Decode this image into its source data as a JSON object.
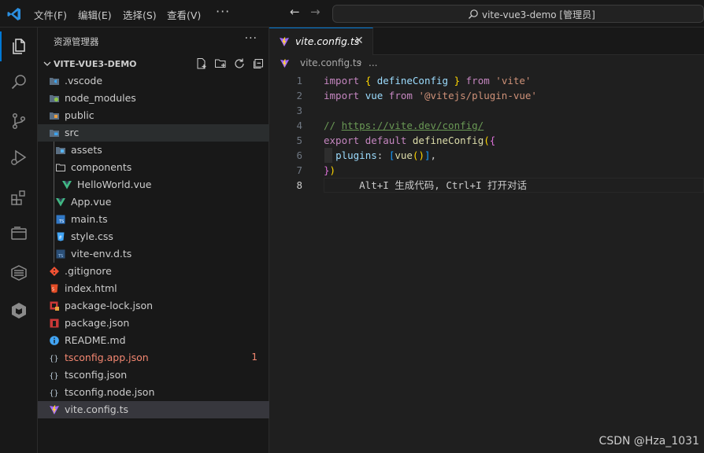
{
  "titlebar": {
    "menus": [
      "文件(F)",
      "编辑(E)",
      "选择(S)",
      "查看(V)"
    ],
    "more": "···",
    "back_arrow": "←",
    "forward_arrow": "→",
    "command_center_text": "vite-vue3-demo [管理员]"
  },
  "sidebar": {
    "title": "资源管理器",
    "more": "···",
    "section_title": "VITE-VUE3-DEMO",
    "tree": [
      {
        "label": ".vscode",
        "icon": "vscode-folder-icon",
        "depth": 0
      },
      {
        "label": "node_modules",
        "icon": "node-folder-icon",
        "depth": 0
      },
      {
        "label": "public",
        "icon": "public-folder-icon",
        "depth": 0
      },
      {
        "label": "src",
        "icon": "src-folder-open-icon",
        "depth": 0
      },
      {
        "label": "assets",
        "icon": "assets-folder-icon",
        "depth": 1
      },
      {
        "label": "components",
        "icon": "folder-outline-icon",
        "depth": 1
      },
      {
        "label": "HelloWorld.vue",
        "icon": "vue-file-icon",
        "depth": 2
      },
      {
        "label": "App.vue",
        "icon": "vue-file-icon",
        "depth": 1
      },
      {
        "label": "main.ts",
        "icon": "ts-file-icon",
        "depth": 1
      },
      {
        "label": "style.css",
        "icon": "css-file-icon",
        "depth": 1
      },
      {
        "label": "vite-env.d.ts",
        "icon": "ts-def-file-icon",
        "depth": 1
      },
      {
        "label": ".gitignore",
        "icon": "git-file-icon",
        "depth": 0
      },
      {
        "label": "index.html",
        "icon": "html-file-icon",
        "depth": 0
      },
      {
        "label": "package-lock.json",
        "icon": "npm-lock-file-icon",
        "depth": 0
      },
      {
        "label": "package.json",
        "icon": "npm-file-icon",
        "depth": 0
      },
      {
        "label": "README.md",
        "icon": "info-file-icon",
        "depth": 0
      },
      {
        "label": "tsconfig.app.json",
        "icon": "json-file-icon",
        "depth": 0,
        "error": true,
        "badge": "1"
      },
      {
        "label": "tsconfig.json",
        "icon": "json-file-icon",
        "depth": 0
      },
      {
        "label": "tsconfig.node.json",
        "icon": "json-file-icon",
        "depth": 0
      },
      {
        "label": "vite.config.ts",
        "icon": "vite-file-icon",
        "depth": 0,
        "selected": true
      }
    ]
  },
  "editor": {
    "tab_label": "vite.config.ts",
    "tab_close": "✕",
    "breadcrumb_file": "vite.config.ts",
    "breadcrumb_sep": "›",
    "breadcrumb_more": "...",
    "line_numbers": [
      "1",
      "2",
      "3",
      "4",
      "5",
      "6",
      "7",
      "8"
    ],
    "current_line": 8,
    "lines": [
      [
        [
          "kw",
          "import"
        ],
        [
          "punc",
          " "
        ],
        [
          "br1",
          "{"
        ],
        [
          "punc",
          " "
        ],
        [
          "id",
          "defineConfig"
        ],
        [
          "punc",
          " "
        ],
        [
          "br1",
          "}"
        ],
        [
          "punc",
          " "
        ],
        [
          "kw",
          "from"
        ],
        [
          "punc",
          " "
        ],
        [
          "str",
          "'vite'"
        ]
      ],
      [
        [
          "kw",
          "import"
        ],
        [
          "punc",
          " "
        ],
        [
          "id",
          "vue"
        ],
        [
          "punc",
          " "
        ],
        [
          "kw",
          "from"
        ],
        [
          "punc",
          " "
        ],
        [
          "str",
          "'@vitejs/plugin-vue'"
        ]
      ],
      [],
      [
        [
          "cm",
          "// "
        ],
        [
          "link",
          "https://vite.dev/config/"
        ]
      ],
      [
        [
          "kw",
          "export"
        ],
        [
          "punc",
          " "
        ],
        [
          "kw",
          "default"
        ],
        [
          "punc",
          " "
        ],
        [
          "fn",
          "defineConfig"
        ],
        [
          "br1",
          "("
        ],
        [
          "br2",
          "{"
        ]
      ],
      [
        [
          "punc",
          "  "
        ],
        [
          "id",
          "plugins"
        ],
        [
          "punc",
          ": "
        ],
        [
          "br3",
          "["
        ],
        [
          "fn",
          "vue"
        ],
        [
          "br1",
          "()"
        ],
        [
          "br3",
          "]"
        ],
        [
          "punc",
          ","
        ]
      ],
      [
        [
          "br2",
          "}"
        ],
        [
          "br1",
          ")"
        ]
      ],
      [
        [
          "hint",
          "      Alt+I 生成代码, Ctrl+I 打开对话"
        ]
      ]
    ]
  },
  "watermark": "CSDN @Hza_1031",
  "colors": {
    "accent": "#0078d4",
    "error": "#f48771",
    "vue": "#41b883"
  }
}
